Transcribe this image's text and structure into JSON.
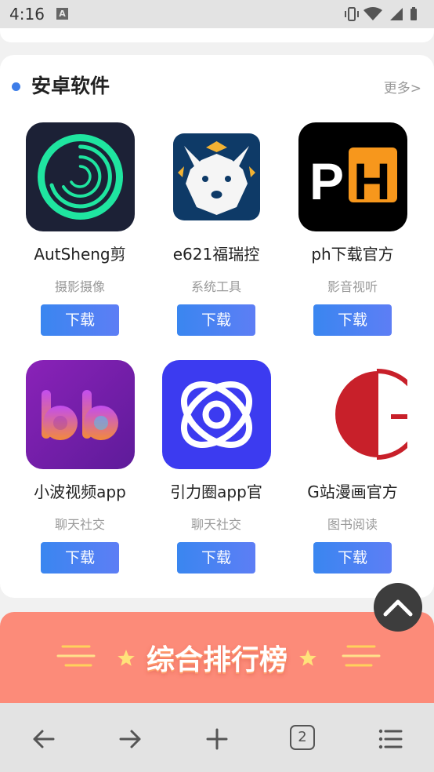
{
  "status_bar": {
    "time": "4:16",
    "notification_icon_letter": "A",
    "icons": [
      "vibrate-icon",
      "wifi-icon",
      "signal-icon",
      "battery-icon"
    ]
  },
  "section": {
    "title": "安卓软件",
    "more": "更多>",
    "accent_color": "#3d7de8"
  },
  "apps": [
    {
      "name": "AutSheng剪",
      "category": "摄影摄像",
      "button": "下载"
    },
    {
      "name": "e621福瑞控",
      "category": "系统工具",
      "button": "下载"
    },
    {
      "name": "ph下载官方",
      "category": "影音视听",
      "button": "下载"
    },
    {
      "name": "小波视频app",
      "category": "聊天社交",
      "button": "下载"
    },
    {
      "name": "引力圈app官",
      "category": "聊天社交",
      "button": "下载"
    },
    {
      "name": "G站漫画官方",
      "category": "图书阅读",
      "button": "下载"
    }
  ],
  "ph_logo": {
    "left": "P",
    "right": "H"
  },
  "banner": {
    "title": "综合排行榜",
    "color": "#fc8b79"
  },
  "browser_nav": {
    "tab_count": "2",
    "icons": [
      "back-arrow-icon",
      "forward-arrow-icon",
      "plus-icon",
      "tabs-icon",
      "menu-icon"
    ]
  }
}
